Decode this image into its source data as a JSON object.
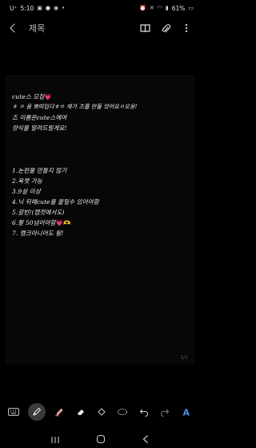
{
  "status_bar": {
    "carrier": "U⁺",
    "time": "5:10",
    "battery": "61%",
    "icons_left": [
      "image-icon",
      "chat-icon",
      "message-icon",
      "dot-icon"
    ],
    "icons_right": [
      "alarm-icon",
      "mute-icon",
      "wifi-icon",
      "signal-icon",
      "battery-icon"
    ]
  },
  "app_bar": {
    "title": "제목",
    "actions": [
      "book-icon",
      "attach-icon",
      "more-icon"
    ]
  },
  "note": {
    "lines": [
      {
        "text": "cute스 모집",
        "suffix": "💗"
      },
      {
        "text": "ㅎ ㅇ 음 뽀띠입다ㅎㅇ 제가 즈를 만들 었어요ㅇ오옹!"
      },
      {
        "text": "즈 이름은cute스에여"
      },
      {
        "text": "양식을 알려드릴게요!"
      },
      {
        "text": "1.논란을 만들지 않기"
      },
      {
        "text": "2.욕챗 가능"
      },
      {
        "text": "3.9살 이상"
      },
      {
        "text": "4.닉 뒤에cute을 붙일수 있어야함"
      },
      {
        "text": "5.갈빈!(캡컷에서도)"
      },
      {
        "text": "6.팔 50넘어야함",
        "suffix": "💗🫶"
      },
      {
        "text": "7. 멤크아니어도 됨!"
      }
    ],
    "page_indicator": "1/1"
  },
  "toolbar": {
    "tools": [
      "keyboard-icon",
      "pen-icon",
      "highlighter-icon",
      "eraser-icon",
      "select-icon",
      "lasso-icon",
      "undo-icon",
      "redo-icon",
      "text-style-icon"
    ],
    "active_tool": "pen-icon"
  },
  "nav_bar": {
    "buttons": [
      "recents-button",
      "home-button",
      "back-button"
    ]
  }
}
